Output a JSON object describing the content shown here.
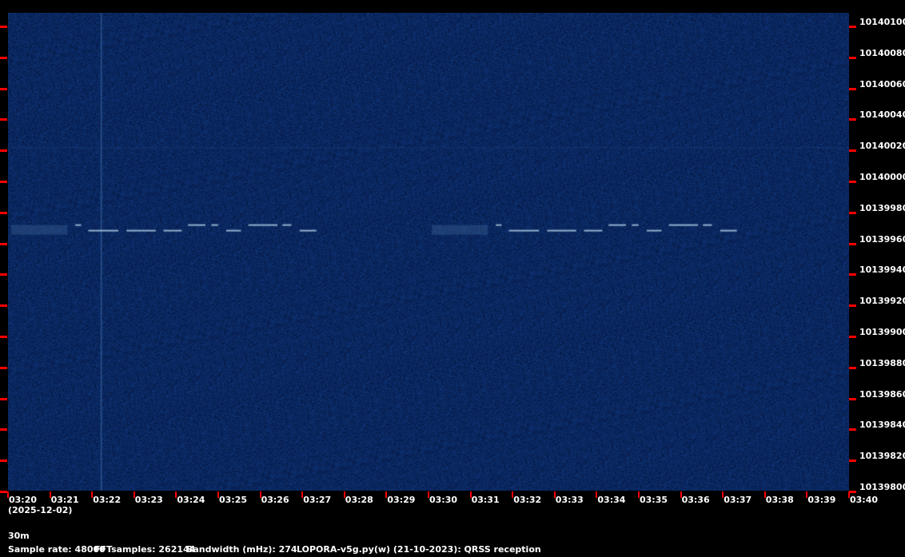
{
  "chart_data": {
    "type": "heatmap",
    "title": "",
    "colormap": [
      "#06163f",
      "#0a2a6a",
      "#8fb3d9"
    ],
    "x_ticks": [
      "03:20",
      "03:21",
      "03:22",
      "03:23",
      "03:24",
      "03:25",
      "03:26",
      "03:27",
      "03:28",
      "03:29",
      "03:30",
      "03:31",
      "03:32",
      "03:33",
      "03:34",
      "03:35",
      "03:36",
      "03:37",
      "03:38",
      "03:39",
      "03:40"
    ],
    "x_date": "(2025-12-02)",
    "y_ticks": [
      "10140100",
      "10140080",
      "10140060",
      "10140040",
      "10140020",
      "10140000",
      "10139980",
      "10139960",
      "10139940",
      "10139920",
      "10139900",
      "10139880",
      "10139860",
      "10139840",
      "10139820",
      "10139800"
    ],
    "xlim": [
      "03:20",
      "03:40"
    ],
    "ylim": [
      10139790,
      10140106
    ],
    "signals": [
      {
        "kind": "QRSS dashes",
        "start": "03:21.6",
        "end": "03:27.4",
        "freq_hz": 10139963
      },
      {
        "kind": "QRSS dashes",
        "start": "03:31.6",
        "end": "03:37.4",
        "freq_hz": 10139963
      },
      {
        "kind": "vertical spur",
        "time": "03:22.2"
      },
      {
        "kind": "horizontal faint line",
        "freq_hz": 10140017
      }
    ]
  },
  "footer": {
    "band": "30m",
    "sample_rate": "Sample rate: 48000",
    "fft": "FFTsamples: 262144",
    "bandwidth": "Bandwidth (mHz): 274",
    "program": "LOPORA-v5g.py(w) (21-10-2023): QRSS reception"
  }
}
